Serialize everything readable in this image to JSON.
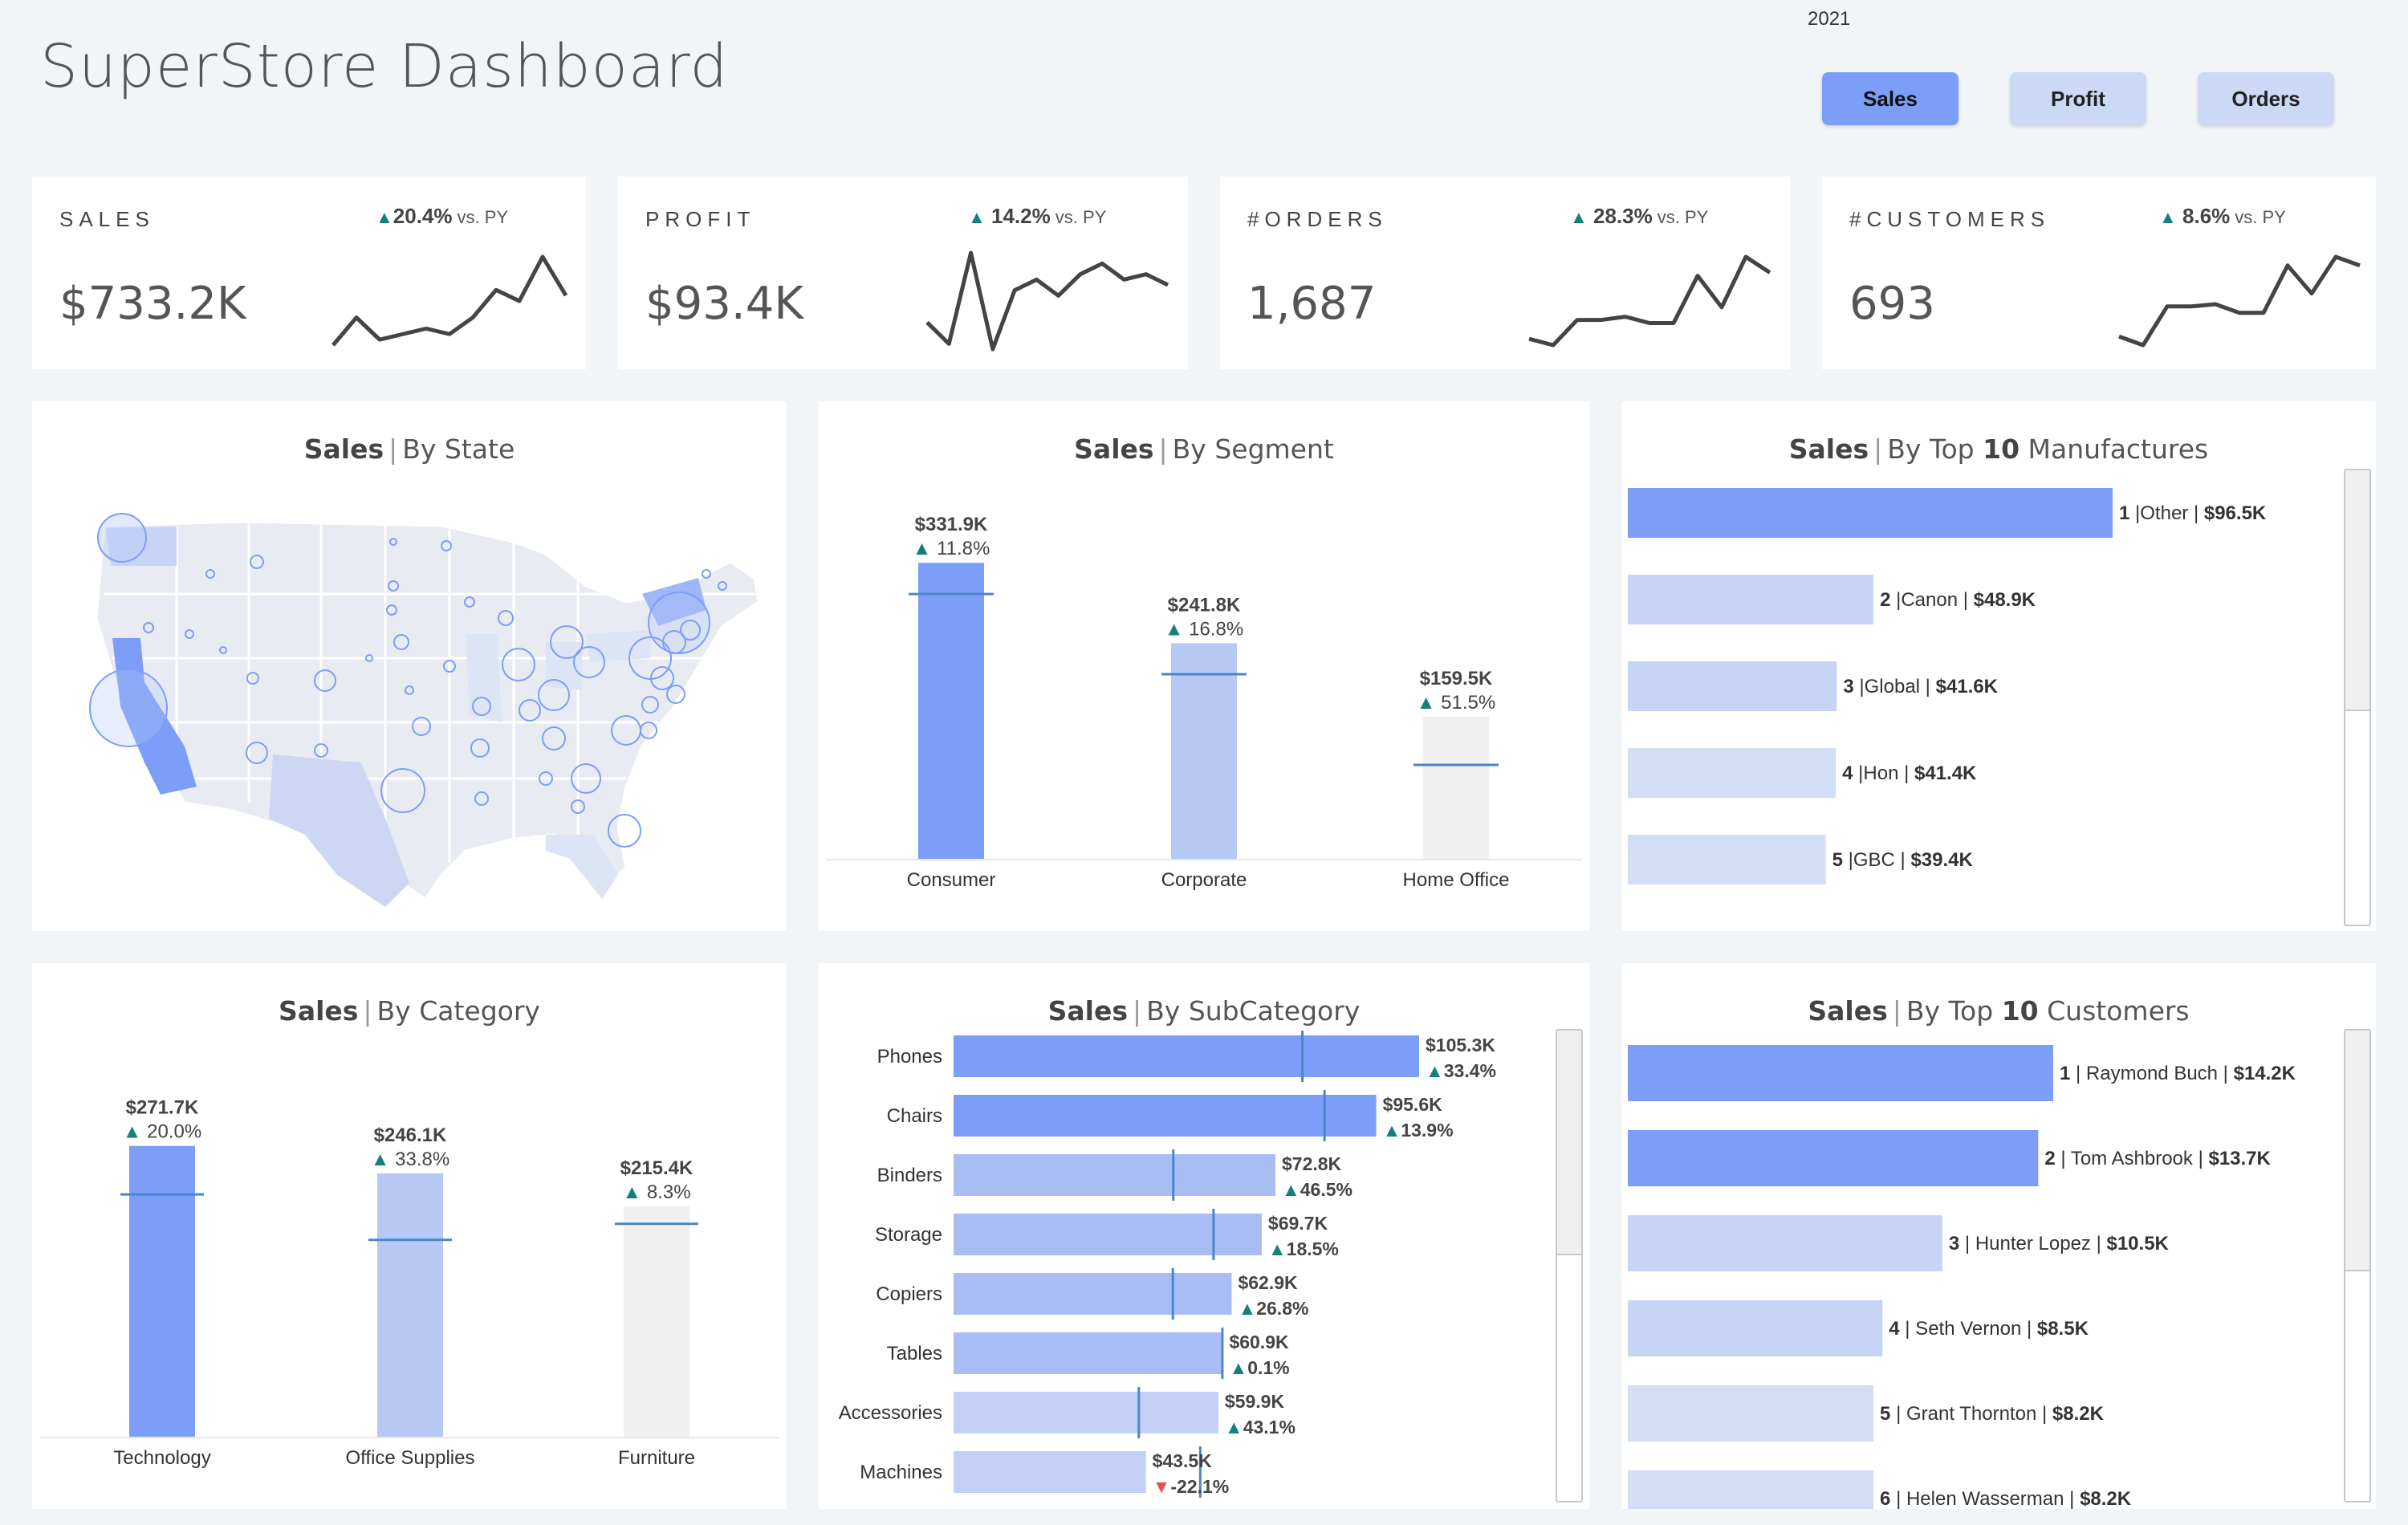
{
  "header": {
    "title": "SuperStore Dashboard",
    "year": "2021",
    "toggles": [
      {
        "label": "Sales",
        "active": true
      },
      {
        "label": "Profit",
        "active": false
      },
      {
        "label": "Orders",
        "active": false
      }
    ]
  },
  "kpis": [
    {
      "label": "SALES",
      "value": "$733.2K",
      "delta": "20.4%",
      "vs": "vs. PY",
      "direction": "up",
      "trend": [
        3,
        8,
        4,
        5,
        6,
        5,
        8,
        13,
        11,
        19,
        12
      ]
    },
    {
      "label": "PROFIT",
      "value": "$93.4K",
      "delta": "14.2%",
      "vs": "vs. PY",
      "direction": "up",
      "trend": [
        5,
        1,
        18,
        0,
        11,
        13,
        10,
        14,
        16,
        13,
        14,
        12
      ]
    },
    {
      "label": "#ORDERS",
      "value": "1,687",
      "delta": "28.3%",
      "vs": "vs. PY",
      "direction": "up",
      "trend": [
        3,
        1,
        9,
        9,
        10,
        8,
        8,
        23,
        13,
        29,
        24
      ]
    },
    {
      "label": "#CUSTOMERS",
      "value": "693",
      "delta": "8.6%",
      "vs": "vs. PY",
      "direction": "up",
      "trend": [
        3,
        1,
        10,
        10,
        10.5,
        8.5,
        8.5,
        19.5,
        13,
        21.5,
        19.5
      ]
    }
  ],
  "panels": {
    "state": {
      "metric": "Sales",
      "title": "By State"
    },
    "segment": {
      "metric": "Sales",
      "title": "By Segment"
    },
    "manufactures": {
      "metric": "Sales",
      "title_pre": "By Top",
      "title_num": "10",
      "title_post": "Manufactures"
    },
    "category": {
      "metric": "Sales",
      "title": "By Category"
    },
    "subcategory": {
      "metric": "Sales",
      "title": "By SubCategory"
    },
    "customers": {
      "metric": "Sales",
      "title_pre": "By Top",
      "title_num": "10",
      "title_post": "Customers"
    }
  },
  "colors": {
    "primary": "#7c9ef8",
    "secondary": "#b7c8f5",
    "tertiary": "#f0f0f0",
    "reference": "#4a86c8",
    "up": "#13807a",
    "down": "#e05555"
  },
  "chart_data": [
    {
      "id": "segment",
      "type": "bar",
      "categories": [
        "Consumer",
        "Corporate",
        "Home Office"
      ],
      "values": [
        331.9,
        241.8,
        159.5
      ],
      "value_labels": [
        "$331.9K",
        "$241.8K",
        "$159.5K"
      ],
      "deltas": [
        "11.8%",
        "16.8%",
        "51.5%"
      ],
      "delta_directions": [
        "up",
        "up",
        "up"
      ],
      "prior_year": [
        296.9,
        207.0,
        105.3
      ],
      "ylim": [
        0,
        360
      ]
    },
    {
      "id": "category",
      "type": "bar",
      "categories": [
        "Technology",
        "Office Supplies",
        "Furniture"
      ],
      "values": [
        271.7,
        246.1,
        215.4
      ],
      "value_labels": [
        "$271.7K",
        "$246.1K",
        "$215.4K"
      ],
      "deltas": [
        "20.0%",
        "33.8%",
        "8.3%"
      ],
      "delta_directions": [
        "up",
        "up",
        "up"
      ],
      "prior_year": [
        226.4,
        183.9,
        198.9
      ],
      "ylim": [
        0,
        300
      ]
    },
    {
      "id": "manufactures",
      "type": "bar",
      "orientation": "horizontal",
      "ranks": [
        "1",
        "2",
        "3",
        "4",
        "5"
      ],
      "categories": [
        "Other",
        "Canon",
        "Global",
        "Hon",
        "GBC"
      ],
      "values": [
        96.5,
        48.9,
        41.6,
        41.4,
        39.4
      ],
      "value_labels": [
        "$96.5K",
        "$48.9K",
        "$41.6K",
        "$41.4K",
        "$39.4K"
      ]
    },
    {
      "id": "subcategory",
      "type": "bar",
      "orientation": "horizontal",
      "categories": [
        "Phones",
        "Chairs",
        "Binders",
        "Storage",
        "Copiers",
        "Tables",
        "Accessories",
        "Machines"
      ],
      "values": [
        105.3,
        95.6,
        72.8,
        69.7,
        62.9,
        60.9,
        59.9,
        43.5
      ],
      "value_labels": [
        "$105.3K",
        "$95.6K",
        "$72.8K",
        "$69.7K",
        "$62.9K",
        "$60.9K",
        "$59.9K",
        "$43.5K"
      ],
      "deltas": [
        "33.4%",
        "13.9%",
        "46.5%",
        "18.5%",
        "26.8%",
        "0.1%",
        "43.1%",
        "-22.1%"
      ],
      "delta_directions": [
        "up",
        "up",
        "up",
        "up",
        "up",
        "up",
        "up",
        "down"
      ],
      "prior_year": [
        78.9,
        83.9,
        49.7,
        58.8,
        49.6,
        60.8,
        41.9,
        55.8
      ]
    },
    {
      "id": "customers",
      "type": "bar",
      "orientation": "horizontal",
      "ranks": [
        "1",
        "2",
        "3",
        "4",
        "5",
        "6"
      ],
      "categories": [
        "Raymond Buch",
        "Tom Ashbrook",
        "Hunter Lopez",
        "Seth Vernon",
        "Grant Thornton",
        "Helen Wasserman"
      ],
      "values": [
        14.2,
        13.7,
        10.5,
        8.5,
        8.2,
        8.2
      ],
      "value_labels": [
        "$14.2K",
        "$13.7K",
        "$10.5K",
        "$8.5K",
        "$8.2K",
        "$8.2K"
      ]
    }
  ]
}
